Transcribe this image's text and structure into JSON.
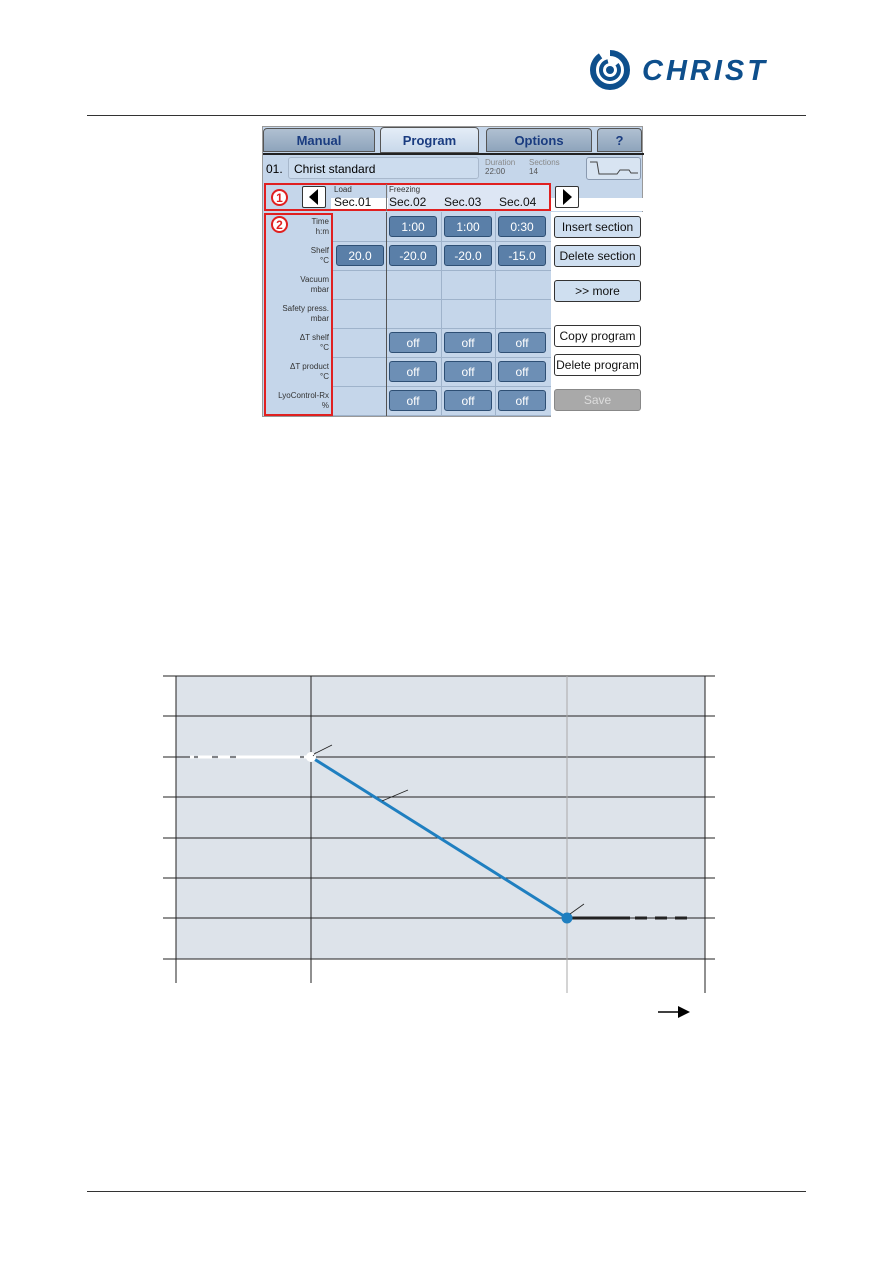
{
  "header": {
    "logo_text": "CHRIST",
    "brand_color": "#0e4f8c"
  },
  "screen": {
    "tabs": [
      {
        "label": "Manual"
      },
      {
        "label": "Program",
        "active": true
      },
      {
        "label": "Options"
      },
      {
        "label": "?"
      }
    ],
    "program_number": "01.",
    "program_name": "Christ standard",
    "duration_label": "Duration",
    "duration_value": "22:00",
    "sections_label": "Sections",
    "sections_value": "14",
    "graph_icon": "program-graph-icon",
    "callouts": [
      "1",
      "2"
    ],
    "phases": [
      "Load",
      "Freezing"
    ],
    "sections": [
      "Sec.01",
      "Sec.02",
      "Sec.03",
      "Sec.04"
    ],
    "rows": [
      {
        "label": "Time",
        "unit": "h:m",
        "values": [
          "",
          "1:00",
          "1:00",
          "0:30"
        ]
      },
      {
        "label": "Shelf",
        "unit": "°C",
        "values": [
          "20.0",
          "-20.0",
          "-20.0",
          "-15.0"
        ]
      },
      {
        "label": "Vacuum",
        "unit": "mbar",
        "values": [
          "",
          "",
          "",
          ""
        ]
      },
      {
        "label": "Safety press.",
        "unit": "mbar",
        "values": [
          "",
          "",
          "",
          ""
        ]
      },
      {
        "label": "ΔT shelf",
        "unit": "°C",
        "values": [
          "",
          "off",
          "off",
          "off"
        ]
      },
      {
        "label": "ΔT product",
        "unit": "°C",
        "values": [
          "",
          "off",
          "off",
          "off"
        ]
      },
      {
        "label": "LyoControl-Rx",
        "unit": "%",
        "values": [
          "",
          "off",
          "off",
          "off"
        ]
      }
    ],
    "buttons": {
      "insert": "Insert section",
      "delete": "Delete section",
      "more": ">> more",
      "copy": "Copy program",
      "delete_program": "Delete program",
      "save": "Save"
    }
  },
  "diagram": {
    "line_color": "#1f7fc0",
    "grid_bg": "#dde3ea"
  }
}
